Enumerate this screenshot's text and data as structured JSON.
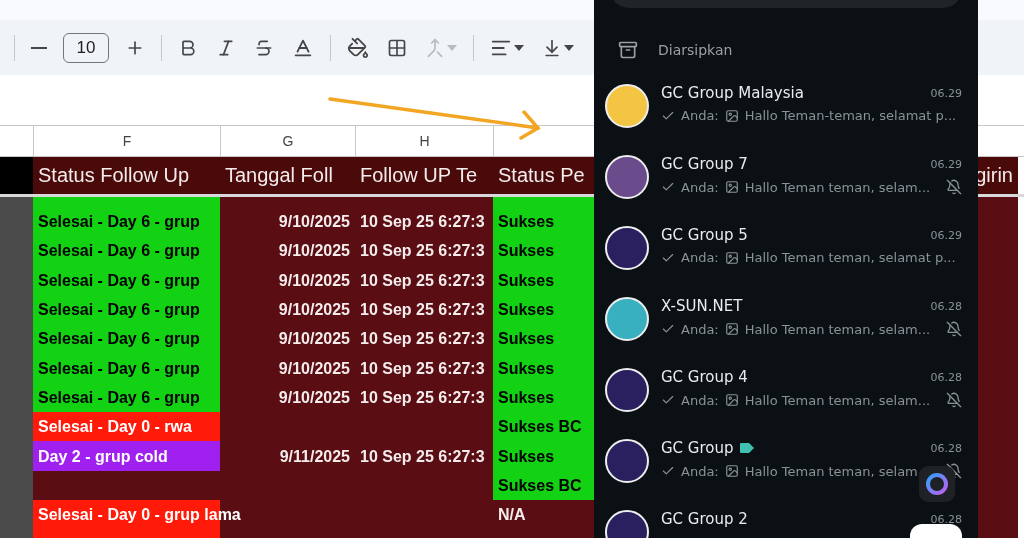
{
  "toolbar": {
    "font_size": "10",
    "merge": {
      "disabled": true
    }
  },
  "sheet": {
    "columns": [
      "F",
      "G",
      "H",
      ""
    ],
    "header": [
      "Status Follow Up",
      "Tanggal Foll",
      "Follow UP Te",
      "Status Pe",
      "girin"
    ],
    "rows": [
      {
        "cells": [
          {
            "text": "",
            "color": "#13d213"
          },
          {
            "text": ""
          },
          {
            "text": ""
          },
          {
            "text": "",
            "color": "#13d213"
          }
        ]
      },
      {
        "cells": [
          {
            "text": "Selesai - Day 6 - grup",
            "color": "#13d213"
          },
          {
            "text": "9/10/2025"
          },
          {
            "text": "10 Sep 25 6:27:3"
          },
          {
            "text": "Sukses",
            "color": "#13d213"
          }
        ]
      },
      {
        "cells": [
          {
            "text": "Selesai - Day 6 - grup",
            "color": "#13d213"
          },
          {
            "text": "9/10/2025"
          },
          {
            "text": "10 Sep 25 6:27:3"
          },
          {
            "text": "Sukses",
            "color": "#13d213"
          }
        ]
      },
      {
        "cells": [
          {
            "text": "Selesai - Day 6 - grup",
            "color": "#13d213"
          },
          {
            "text": "9/10/2025"
          },
          {
            "text": "10 Sep 25 6:27:3"
          },
          {
            "text": "Sukses",
            "color": "#13d213"
          }
        ]
      },
      {
        "cells": [
          {
            "text": "Selesai - Day 6 - grup",
            "color": "#13d213"
          },
          {
            "text": "9/10/2025"
          },
          {
            "text": "10 Sep 25 6:27:3"
          },
          {
            "text": "Sukses",
            "color": "#13d213"
          }
        ]
      },
      {
        "cells": [
          {
            "text": "Selesai - Day 6 - grup",
            "color": "#13d213"
          },
          {
            "text": "9/10/2025"
          },
          {
            "text": "10 Sep 25 6:27:3"
          },
          {
            "text": "Sukses",
            "color": "#13d213"
          }
        ]
      },
      {
        "cells": [
          {
            "text": "Selesai - Day 6 - grup",
            "color": "#13d213"
          },
          {
            "text": "9/10/2025"
          },
          {
            "text": "10 Sep 25 6:27:3"
          },
          {
            "text": "Sukses",
            "color": "#13d213"
          }
        ]
      },
      {
        "cells": [
          {
            "text": "Selesai - Day 6 - grup",
            "color": "#13d213"
          },
          {
            "text": "9/10/2025"
          },
          {
            "text": "10 Sep 25 6:27:3"
          },
          {
            "text": "Sukses",
            "color": "#13d213"
          }
        ]
      },
      {
        "cells": [
          {
            "text": "Selesai - Day 0 - rwa",
            "color": "#ff1a0a"
          },
          {
            "text": ""
          },
          {
            "text": ""
          },
          {
            "text": "Sukses BC",
            "color": "#13d213"
          }
        ]
      },
      {
        "cells": [
          {
            "text": "Day 2 - grup cold",
            "color": "#a020f0"
          },
          {
            "text": "9/11/2025"
          },
          {
            "text": "10 Sep 25 6:27:3"
          },
          {
            "text": "Sukses",
            "color": "#13d213"
          }
        ]
      },
      {
        "cells": [
          {
            "text": ""
          },
          {
            "text": ""
          },
          {
            "text": ""
          },
          {
            "text": "Sukses BC",
            "color": "#13d213"
          }
        ]
      },
      {
        "cells": [
          {
            "text": "Selesai - Day 0 - grup lama",
            "color": "#ff1a0a"
          },
          {
            "text": ""
          },
          {
            "text": ""
          },
          {
            "text": "N/A"
          }
        ]
      },
      {
        "cells": [
          {
            "text": "",
            "color": "#ff1a0a"
          },
          {
            "text": ""
          },
          {
            "text": ""
          },
          {
            "text": ""
          }
        ]
      }
    ]
  },
  "chat_panel": {
    "archived_label": "Diarsipkan",
    "chats": [
      {
        "name": "GC Group Malaysia",
        "time": "06.29",
        "sender": "Anda:",
        "preview": "Hallo Teman-teman, selamat p...",
        "muted": false,
        "tagged": false
      },
      {
        "name": "GC Group 7",
        "time": "06.29",
        "sender": "Anda:",
        "preview": "Hallo Teman teman, selam...",
        "muted": true,
        "tagged": false
      },
      {
        "name": "GC Group 5",
        "time": "06.29",
        "sender": "Anda:",
        "preview": "Hallo Teman teman, selamat p...",
        "muted": false,
        "tagged": false
      },
      {
        "name": "X-SUN.NET",
        "time": "06.28",
        "sender": "Anda:",
        "preview": "Hallo Teman teman, selam...",
        "muted": true,
        "tagged": false
      },
      {
        "name": "GC Group 4",
        "time": "06.28",
        "sender": "Anda:",
        "preview": "Hallo Teman teman, selam...",
        "muted": true,
        "tagged": false
      },
      {
        "name": "GC Group",
        "time": "06.28",
        "sender": "Anda:",
        "preview": "Hallo Teman teman, selam",
        "muted": true,
        "tagged": true
      },
      {
        "name": "GC Group 2",
        "time": "06.28"
      }
    ]
  }
}
